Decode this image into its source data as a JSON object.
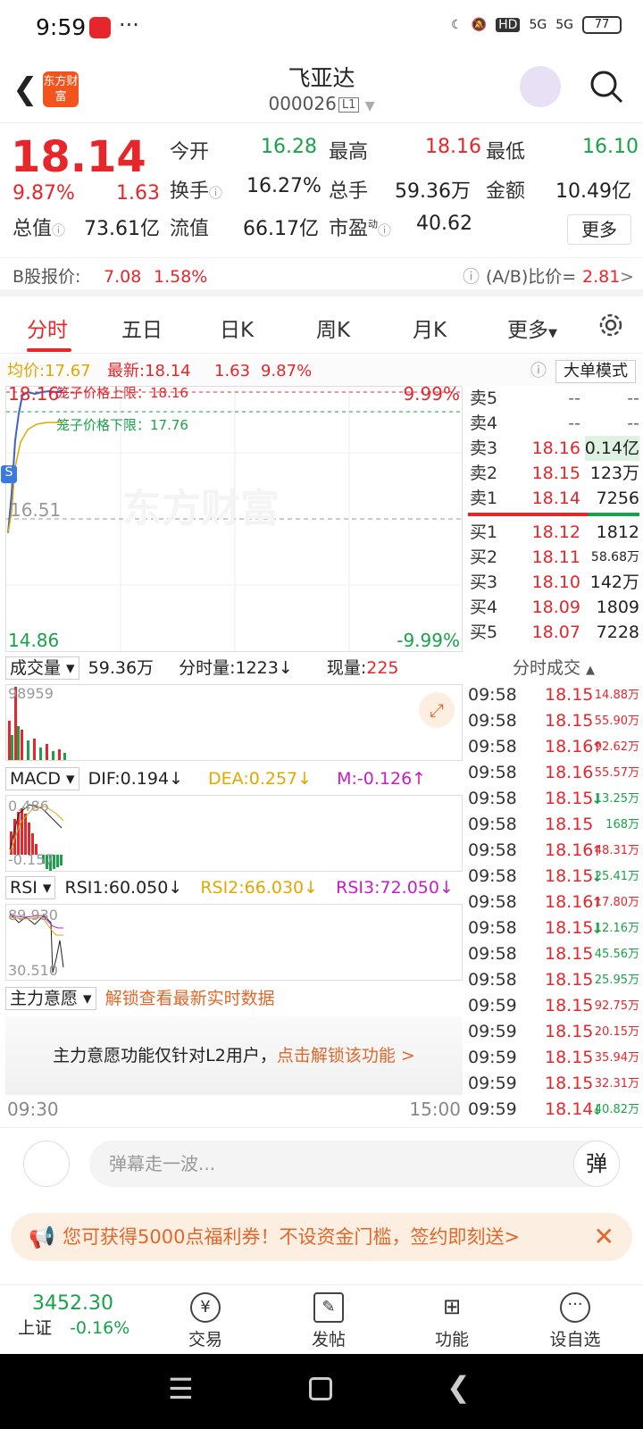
{
  "status": {
    "time": "9:59",
    "dots": "···",
    "hd": "HD",
    "net1": "5G",
    "net2": "5G",
    "battery": "77"
  },
  "header": {
    "logo": "东方财富",
    "name": "飞亚达",
    "code": "000026",
    "level": "L1"
  },
  "quote": {
    "price": "18.14",
    "pct": "9.87%",
    "chg": "1.63",
    "open_label": "今开",
    "open": "16.28",
    "high_label": "最高",
    "high": "18.16",
    "low_label": "最低",
    "low": "16.10",
    "turn_label": "换手",
    "turn": "16.27%",
    "vol_label": "总手",
    "vol": "59.36万",
    "amt_label": "金额",
    "amt": "10.49亿",
    "mcap_label": "总值",
    "mcap": "73.61亿",
    "fcap_label": "流值",
    "fcap": "66.17亿",
    "pe_label": "市盈",
    "pe_sup": "动",
    "pe": "40.62",
    "more": "更多"
  },
  "bshare": {
    "label": "B股报价:",
    "price": "7.08",
    "pct": "1.58%",
    "ratio_label": "(A/B)比价=",
    "ratio": "2.81",
    "arrow": ">"
  },
  "tabs": [
    "分时",
    "五日",
    "日K",
    "周K",
    "月K",
    "更多"
  ],
  "chartbar": {
    "avg_label": "均价:",
    "avg": "17.67",
    "last_label": "最新:",
    "last": "18.14",
    "chg": "1.63",
    "pct": "9.87%",
    "mode": "大单模式"
  },
  "main_chart": {
    "upper": "18.16",
    "lower": "14.86",
    "mid": "16.51",
    "up_pct": "9.99%",
    "down_pct": "-9.99%",
    "cage_up": "笼子价格上限：18.16",
    "cage_down": "笼子价格下限：17.76",
    "watermark": "东方财富",
    "s_mark": "S"
  },
  "book": {
    "sells": [
      {
        "l": "卖5",
        "p": "--",
        "v": "--"
      },
      {
        "l": "卖4",
        "p": "--",
        "v": "--"
      },
      {
        "l": "卖3",
        "p": "18.16",
        "v": "0.14亿"
      },
      {
        "l": "卖2",
        "p": "18.15",
        "v": "123万"
      },
      {
        "l": "卖1",
        "p": "18.14",
        "v": "7256"
      }
    ],
    "buys": [
      {
        "l": "买1",
        "p": "18.12",
        "v": "1812"
      },
      {
        "l": "买2",
        "p": "18.11",
        "v": "58.68万"
      },
      {
        "l": "买3",
        "p": "18.10",
        "v": "142万"
      },
      {
        "l": "买4",
        "p": "18.09",
        "v": "1809"
      },
      {
        "l": "买5",
        "p": "18.07",
        "v": "7228"
      }
    ]
  },
  "vol": {
    "sel": "成交量",
    "total": "59.36万",
    "min_label": "分时量:",
    "min": "1223",
    "arrow": "↓",
    "cur_label": "现量:",
    "cur": "225",
    "max": "98959"
  },
  "macd": {
    "sel": "MACD",
    "dif": "DIF:0.194↓",
    "dea": "DEA:0.257↓",
    "m": "M:-0.126↑",
    "top": "0.486",
    "bot": "-0.157"
  },
  "rsi": {
    "sel": "RSI",
    "r1": "RSI1:60.050↓",
    "r2": "RSI2:66.030↓",
    "r3": "RSI3:72.050↓",
    "top": "89.930",
    "bot": "30.510"
  },
  "zl": {
    "sel": "主力意愿",
    "unlock": "解锁查看最新实时数据",
    "note": "主力意愿功能仅针对L2用户，",
    "link": "点击解锁该功能 >"
  },
  "timeaxis": {
    "start": "09:30",
    "end": "15:00"
  },
  "ticks": {
    "title": "分时成交",
    "rows": [
      {
        "t": "09:58",
        "p": "18.15",
        "a": "14.88万",
        "c": "r",
        "ar": ""
      },
      {
        "t": "09:58",
        "p": "18.15",
        "a": "55.90万",
        "c": "r",
        "ar": ""
      },
      {
        "t": "09:58",
        "p": "18.16",
        "a": "92.62万",
        "c": "r",
        "ar": "↑"
      },
      {
        "t": "09:58",
        "p": "18.16",
        "a": "55.57万",
        "c": "r",
        "ar": ""
      },
      {
        "t": "09:58",
        "p": "18.15",
        "a": "13.25万",
        "c": "g",
        "ar": "↓"
      },
      {
        "t": "09:58",
        "p": "18.15",
        "a": "168万",
        "c": "g",
        "ar": ""
      },
      {
        "t": "09:58",
        "p": "18.16",
        "a": "48.31万",
        "c": "r",
        "ar": "↑"
      },
      {
        "t": "09:58",
        "p": "18.15",
        "a": "25.41万",
        "c": "g",
        "ar": "↓"
      },
      {
        "t": "09:58",
        "p": "18.16",
        "a": "17.80万",
        "c": "r",
        "ar": "↑"
      },
      {
        "t": "09:58",
        "p": "18.15",
        "a": "12.16万",
        "c": "g",
        "ar": "↓"
      },
      {
        "t": "09:58",
        "p": "18.15",
        "a": "45.56万",
        "c": "g",
        "ar": ""
      },
      {
        "t": "09:58",
        "p": "18.15",
        "a": "25.95万",
        "c": "g",
        "ar": ""
      },
      {
        "t": "09:59",
        "p": "18.15",
        "a": "92.75万",
        "c": "r",
        "ar": ""
      },
      {
        "t": "09:59",
        "p": "18.15",
        "a": "20.15万",
        "c": "r",
        "ar": ""
      },
      {
        "t": "09:59",
        "p": "18.15",
        "a": "35.94万",
        "c": "r",
        "ar": ""
      },
      {
        "t": "09:59",
        "p": "18.15",
        "a": "32.31万",
        "c": "r",
        "ar": ""
      },
      {
        "t": "09:59",
        "p": "18.14",
        "a": "40.82万",
        "c": "g",
        "ar": "↓"
      }
    ]
  },
  "danmu": {
    "placeholder": "弹幕走一波...",
    "btn": "弹"
  },
  "promo": {
    "msg": "您可获得5000点福利券！不设资金门槛，签约即刻送>",
    "close": "✕"
  },
  "bottom": {
    "index": "3452.30",
    "index_name": "上证",
    "index_pct": "-0.16%",
    "items": [
      "交易",
      "发帖",
      "功能",
      "设自选"
    ]
  },
  "colors": {
    "up": "#e6262b",
    "down": "#19a24a",
    "accent": "#f3541e"
  }
}
